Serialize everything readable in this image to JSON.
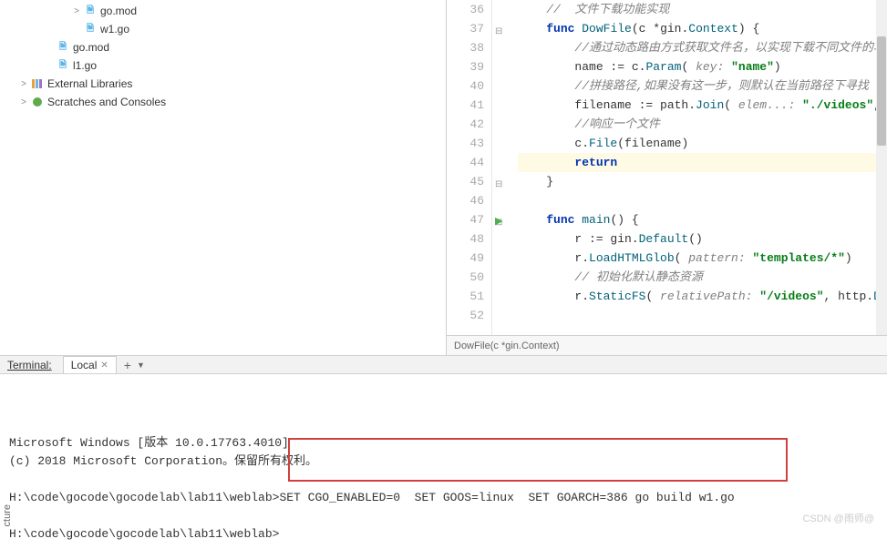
{
  "sidebar": {
    "items": [
      {
        "label": "go.mod",
        "icon": "go",
        "indent": 3,
        "chevron": ">"
      },
      {
        "label": "w1.go",
        "icon": "go",
        "indent": 3,
        "chevron": ""
      },
      {
        "label": "go.mod",
        "icon": "go",
        "indent": 2,
        "chevron": ""
      },
      {
        "label": "l1.go",
        "icon": "go",
        "indent": 2,
        "chevron": ""
      },
      {
        "label": "External Libraries",
        "icon": "lib",
        "indent": 1,
        "chevron": ">"
      },
      {
        "label": "Scratches and Consoles",
        "icon": "scratch",
        "indent": 1,
        "chevron": ">"
      }
    ]
  },
  "editor": {
    "lines": [
      {
        "num": 36,
        "fold": "",
        "html": "    <span class='comment'>//  文件下载功能实现</span>"
      },
      {
        "num": 37,
        "fold": "⊟",
        "html": "    <span class='kw'>func</span> <span class='fn'>DowFile</span>(c *gin.<span class='type'>Context</span>) {"
      },
      {
        "num": 38,
        "fold": "",
        "html": "        <span class='comment'>//通过动态路由方式获取文件名，以实现下载不同文件的功能</span>"
      },
      {
        "num": 39,
        "fold": "",
        "html": "        name := c.<span class='fn'>Param</span>( <span class='param'>key:</span> <span class='str'>\"name\"</span>)"
      },
      {
        "num": 40,
        "fold": "",
        "html": "        <span class='comment'>//拼接路径,如果没有这一步，则默认在当前路径下寻找</span>"
      },
      {
        "num": 41,
        "fold": "",
        "html": "        filename := path.<span class='fn'>Join</span>( <span class='param'>elem...:</span> <span class='str'>\"./videos\"</span>, name)"
      },
      {
        "num": 42,
        "fold": "",
        "html": "        <span class='comment'>//响应一个文件</span>"
      },
      {
        "num": 43,
        "fold": "",
        "html": "        c.<span class='fn'>File</span>(filename)"
      },
      {
        "num": 44,
        "fold": "",
        "hl": true,
        "html": "        <span class='kw'>return</span>"
      },
      {
        "num": 45,
        "fold": "⊟",
        "html": "    }"
      },
      {
        "num": 46,
        "fold": "",
        "html": ""
      },
      {
        "num": 47,
        "fold": "⊟",
        "run": true,
        "html": "    <span class='kw'>func</span> <span class='fn'>main</span>() {"
      },
      {
        "num": 48,
        "fold": "",
        "html": "        r := gin.<span class='fn'>Default</span>()"
      },
      {
        "num": 49,
        "fold": "",
        "html": "        r.<span class='fn'>LoadHTMLGlob</span>( <span class='param'>pattern:</span> <span class='str'>\"templates/*\"</span>)"
      },
      {
        "num": 50,
        "fold": "",
        "html": "        <span class='comment'>// 初始化默认静态资源</span>"
      },
      {
        "num": 51,
        "fold": "",
        "html": "        r.<span class='fn'>StaticFS</span>( <span class='param'>relativePath:</span> <span class='str'>\"/videos\"</span>, http.<span class='fn'>Dir</span>(<span class='str'>\"./vid</span>"
      },
      {
        "num": 52,
        "fold": "",
        "html": ""
      }
    ],
    "breadcrumb": "DowFile(c *gin.Context)"
  },
  "terminal": {
    "title": "Terminal:",
    "tab": "Local",
    "lines": [
      "Microsoft Windows [版本 10.0.17763.4010]",
      "(c) 2018 Microsoft Corporation。保留所有权利。",
      "",
      "H:\\code\\gocode\\gocodelab\\lab11\\weblab>SET CGO_ENABLED=0  SET GOOS=linux  SET GOARCH=386 go build w1.go",
      "",
      "H:\\code\\gocode\\gocodelab\\lab11\\weblab>"
    ]
  },
  "bottom_label": "cture",
  "watermark": "CSDN @雨师@"
}
